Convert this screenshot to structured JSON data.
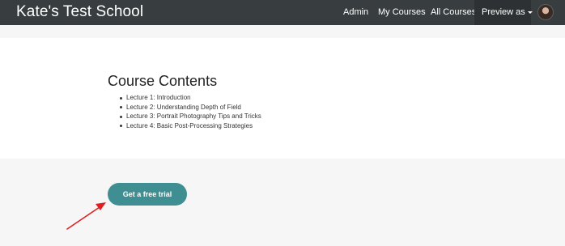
{
  "navbar": {
    "brand": "Kate's Test School",
    "links": [
      "Admin",
      "My Courses",
      "All Courses"
    ],
    "preview_label": "Preview as"
  },
  "course_contents": {
    "title": "Course Contents",
    "lectures": [
      "Lecture 1: Introduction",
      "Lecture 2: Understanding Depth of Field",
      "Lecture 3: Portrait Photography Tips and Tricks",
      "Lecture 4: Basic Post-Processing Strategies"
    ]
  },
  "cta": {
    "label": "Get a free trial",
    "color": "#3f8e91"
  },
  "annotation": {
    "arrow_color": "#e02020"
  }
}
